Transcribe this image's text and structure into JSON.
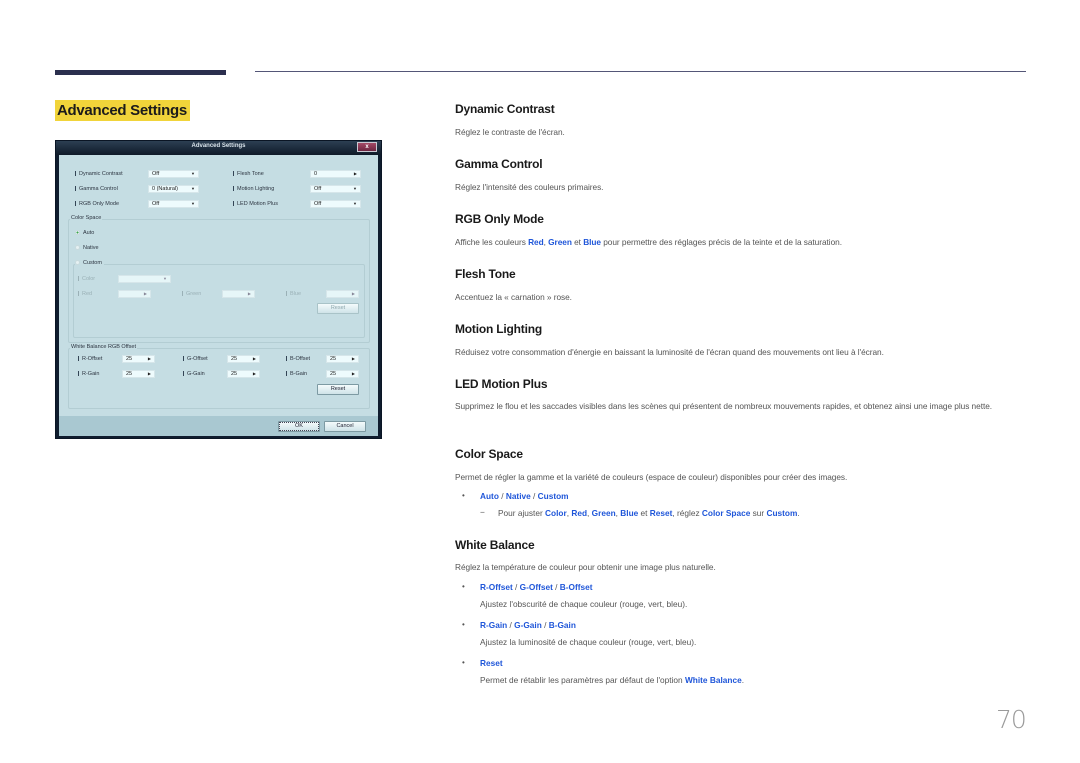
{
  "section_title": "Advanced Settings",
  "dialog": {
    "title": "Advanced Settings",
    "close_label": "x",
    "rows": [
      {
        "label": "Dynamic Contrast",
        "value": "Off"
      },
      {
        "label": "Gamma Control",
        "value": "0 (Natural)"
      },
      {
        "label": "RGB Only Mode",
        "value": "Off"
      },
      {
        "label": "Flesh Tone",
        "value": "0"
      },
      {
        "label": "Motion Lighting",
        "value": "Off"
      },
      {
        "label": "LED Motion Plus",
        "value": "Off"
      }
    ],
    "color_space": {
      "label": "Color Space",
      "options": [
        "Auto",
        "Native",
        "Custom"
      ],
      "selected": "Auto",
      "color_label": "Color",
      "color_value": "",
      "red_label": "Red",
      "green_label": "Green",
      "blue_label": "Blue",
      "reset_label": "Reset"
    },
    "white_balance": {
      "label": "White Balance RGB Offset",
      "fields": [
        {
          "label": "R-Offset",
          "value": "25"
        },
        {
          "label": "G-Offset",
          "value": "25"
        },
        {
          "label": "B-Offset",
          "value": "25"
        },
        {
          "label": "R-Gain",
          "value": "25"
        },
        {
          "label": "G-Gain",
          "value": "25"
        },
        {
          "label": "B-Gain",
          "value": "25"
        }
      ],
      "reset_label": "Reset"
    },
    "ok_label": "OK",
    "cancel_label": "Cancel"
  },
  "content": {
    "dynamic_contrast": {
      "title": "Dynamic Contrast",
      "text": "Réglez le contraste de l'écran."
    },
    "gamma_control": {
      "title": "Gamma Control",
      "text": "Réglez l'intensité des couleurs primaires."
    },
    "rgb_only_mode": {
      "title": "RGB Only Mode",
      "text_1": "Affiche les couleurs ",
      "red": "Red",
      "sep": ", ",
      "green": "Green",
      "et": " et ",
      "blue": "Blue",
      "text_2": " pour permettre des réglages précis de la teinte et de la saturation."
    },
    "flesh_tone": {
      "title": "Flesh Tone",
      "text": "Accentuez la « carnation » rose."
    },
    "motion_lighting": {
      "title": "Motion Lighting",
      "text": "Réduisez votre consommation d'énergie en baissant la luminosité de l'écran quand des mouvements ont lieu à l'écran."
    },
    "led_motion_plus": {
      "title": "LED Motion Plus",
      "text": "Supprimez le flou et les saccades visibles dans les scènes qui présentent de nombreux mouvements rapides, et obtenez ainsi une image plus nette."
    },
    "color_space": {
      "title": "Color Space",
      "text": "Permet de régler la gamme et la variété de couleurs (espace de couleur) disponibles pour créer des images.",
      "bullet": {
        "auto": "Auto",
        "native": "Native",
        "custom": "Custom",
        "slash": " / "
      },
      "note": {
        "dash": "−",
        "t1": "Pour ajuster ",
        "color": "Color",
        "comma": ", ",
        "red": "Red",
        "green": "Green",
        "blue": "Blue",
        "et": " et ",
        "reset": "Reset",
        "t2": ", réglez ",
        "color_space": "Color Space",
        "sur": " sur ",
        "custom": "Custom",
        "end": "."
      }
    },
    "white_balance": {
      "title": "White Balance",
      "text": "Réglez la température de couleur pour obtenir une image plus naturelle.",
      "offset": {
        "r": "R-Offset",
        "g": "G-Offset",
        "b": "B-Offset",
        "slash": " / ",
        "desc": "Ajustez l'obscurité de chaque couleur (rouge, vert, bleu)."
      },
      "gain": {
        "r": "R-Gain",
        "g": "G-Gain",
        "b": "B-Gain",
        "slash": " / ",
        "desc": "Ajustez la luminosité de chaque couleur (rouge, vert, bleu)."
      },
      "reset": {
        "label": "Reset",
        "desc_1": "Permet de rétablir les paramètres par défaut de l'option ",
        "wb": "White Balance",
        "desc_2": "."
      }
    }
  },
  "bullet_char": "•",
  "page_number": "70",
  "colors": {
    "highlight": "#f1d43a",
    "link_blue": "#1f56d9",
    "rule": "#2b2f4e"
  }
}
